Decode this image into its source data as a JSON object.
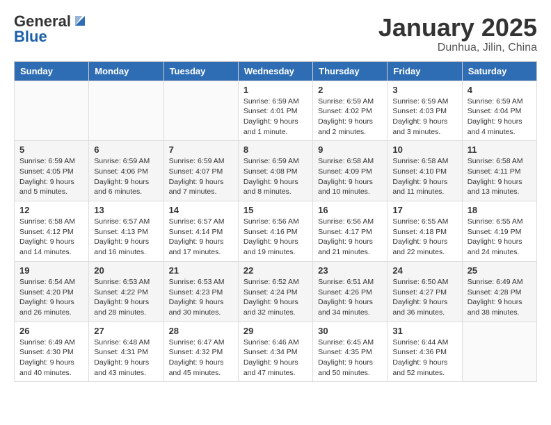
{
  "header": {
    "logo_general": "General",
    "logo_blue": "Blue",
    "title": "January 2025",
    "subtitle": "Dunhua, Jilin, China"
  },
  "weekdays": [
    "Sunday",
    "Monday",
    "Tuesday",
    "Wednesday",
    "Thursday",
    "Friday",
    "Saturday"
  ],
  "weeks": [
    [
      {
        "day": "",
        "info": ""
      },
      {
        "day": "",
        "info": ""
      },
      {
        "day": "",
        "info": ""
      },
      {
        "day": "1",
        "info": "Sunrise: 6:59 AM\nSunset: 4:01 PM\nDaylight: 9 hours and 1 minute."
      },
      {
        "day": "2",
        "info": "Sunrise: 6:59 AM\nSunset: 4:02 PM\nDaylight: 9 hours and 2 minutes."
      },
      {
        "day": "3",
        "info": "Sunrise: 6:59 AM\nSunset: 4:03 PM\nDaylight: 9 hours and 3 minutes."
      },
      {
        "day": "4",
        "info": "Sunrise: 6:59 AM\nSunset: 4:04 PM\nDaylight: 9 hours and 4 minutes."
      }
    ],
    [
      {
        "day": "5",
        "info": "Sunrise: 6:59 AM\nSunset: 4:05 PM\nDaylight: 9 hours and 5 minutes."
      },
      {
        "day": "6",
        "info": "Sunrise: 6:59 AM\nSunset: 4:06 PM\nDaylight: 9 hours and 6 minutes."
      },
      {
        "day": "7",
        "info": "Sunrise: 6:59 AM\nSunset: 4:07 PM\nDaylight: 9 hours and 7 minutes."
      },
      {
        "day": "8",
        "info": "Sunrise: 6:59 AM\nSunset: 4:08 PM\nDaylight: 9 hours and 8 minutes."
      },
      {
        "day": "9",
        "info": "Sunrise: 6:58 AM\nSunset: 4:09 PM\nDaylight: 9 hours and 10 minutes."
      },
      {
        "day": "10",
        "info": "Sunrise: 6:58 AM\nSunset: 4:10 PM\nDaylight: 9 hours and 11 minutes."
      },
      {
        "day": "11",
        "info": "Sunrise: 6:58 AM\nSunset: 4:11 PM\nDaylight: 9 hours and 13 minutes."
      }
    ],
    [
      {
        "day": "12",
        "info": "Sunrise: 6:58 AM\nSunset: 4:12 PM\nDaylight: 9 hours and 14 minutes."
      },
      {
        "day": "13",
        "info": "Sunrise: 6:57 AM\nSunset: 4:13 PM\nDaylight: 9 hours and 16 minutes."
      },
      {
        "day": "14",
        "info": "Sunrise: 6:57 AM\nSunset: 4:14 PM\nDaylight: 9 hours and 17 minutes."
      },
      {
        "day": "15",
        "info": "Sunrise: 6:56 AM\nSunset: 4:16 PM\nDaylight: 9 hours and 19 minutes."
      },
      {
        "day": "16",
        "info": "Sunrise: 6:56 AM\nSunset: 4:17 PM\nDaylight: 9 hours and 21 minutes."
      },
      {
        "day": "17",
        "info": "Sunrise: 6:55 AM\nSunset: 4:18 PM\nDaylight: 9 hours and 22 minutes."
      },
      {
        "day": "18",
        "info": "Sunrise: 6:55 AM\nSunset: 4:19 PM\nDaylight: 9 hours and 24 minutes."
      }
    ],
    [
      {
        "day": "19",
        "info": "Sunrise: 6:54 AM\nSunset: 4:20 PM\nDaylight: 9 hours and 26 minutes."
      },
      {
        "day": "20",
        "info": "Sunrise: 6:53 AM\nSunset: 4:22 PM\nDaylight: 9 hours and 28 minutes."
      },
      {
        "day": "21",
        "info": "Sunrise: 6:53 AM\nSunset: 4:23 PM\nDaylight: 9 hours and 30 minutes."
      },
      {
        "day": "22",
        "info": "Sunrise: 6:52 AM\nSunset: 4:24 PM\nDaylight: 9 hours and 32 minutes."
      },
      {
        "day": "23",
        "info": "Sunrise: 6:51 AM\nSunset: 4:26 PM\nDaylight: 9 hours and 34 minutes."
      },
      {
        "day": "24",
        "info": "Sunrise: 6:50 AM\nSunset: 4:27 PM\nDaylight: 9 hours and 36 minutes."
      },
      {
        "day": "25",
        "info": "Sunrise: 6:49 AM\nSunset: 4:28 PM\nDaylight: 9 hours and 38 minutes."
      }
    ],
    [
      {
        "day": "26",
        "info": "Sunrise: 6:49 AM\nSunset: 4:30 PM\nDaylight: 9 hours and 40 minutes."
      },
      {
        "day": "27",
        "info": "Sunrise: 6:48 AM\nSunset: 4:31 PM\nDaylight: 9 hours and 43 minutes."
      },
      {
        "day": "28",
        "info": "Sunrise: 6:47 AM\nSunset: 4:32 PM\nDaylight: 9 hours and 45 minutes."
      },
      {
        "day": "29",
        "info": "Sunrise: 6:46 AM\nSunset: 4:34 PM\nDaylight: 9 hours and 47 minutes."
      },
      {
        "day": "30",
        "info": "Sunrise: 6:45 AM\nSunset: 4:35 PM\nDaylight: 9 hours and 50 minutes."
      },
      {
        "day": "31",
        "info": "Sunrise: 6:44 AM\nSunset: 4:36 PM\nDaylight: 9 hours and 52 minutes."
      },
      {
        "day": "",
        "info": ""
      }
    ]
  ]
}
